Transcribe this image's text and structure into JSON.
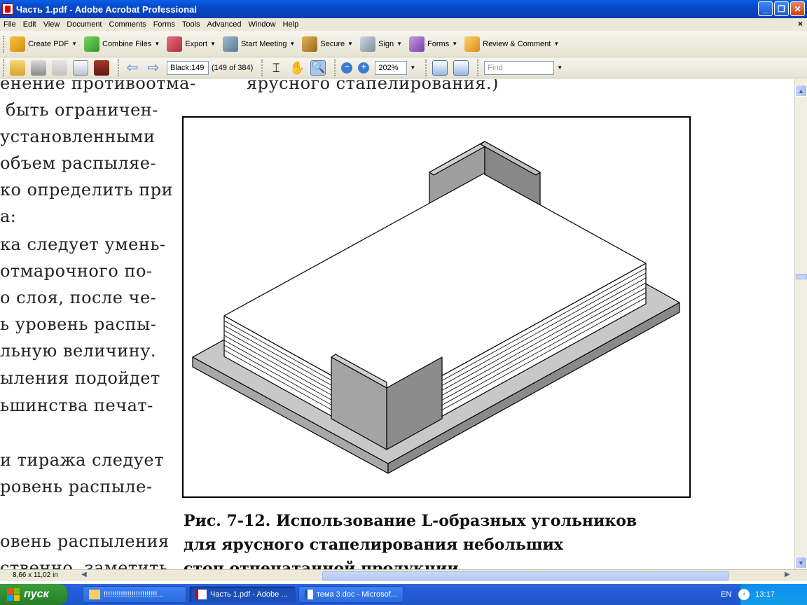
{
  "window": {
    "title": "Часть 1.pdf - Adobe Acrobat Professional"
  },
  "menu": {
    "items": [
      "File",
      "Edit",
      "View",
      "Document",
      "Comments",
      "Forms",
      "Tools",
      "Advanced",
      "Window",
      "Help"
    ],
    "close": "×"
  },
  "toolbar1": {
    "create_pdf": "Create PDF",
    "combine_files": "Combine Files",
    "export": "Export",
    "start_meeting": "Start Meeting",
    "secure": "Secure",
    "sign": "Sign",
    "forms": "Forms",
    "review_comment": "Review & Comment"
  },
  "toolbar2": {
    "page_field": "Black:149",
    "page_count": "(149 of 384)",
    "zoom": "202%",
    "find_placeholder": "Find"
  },
  "document": {
    "left_lines": [
      "енение противоотма-",
      "быть ограничен-",
      "установленными",
      "объем распыляе-",
      "ко определить при",
      "а:",
      "ка следует умень-",
      "отмарочного по-",
      "о слоя, после че-",
      "ь уровень распы-",
      "льную величину.",
      "ыления подойдет",
      "ьшинства печат-",
      "",
      "и тиража следует",
      "ровень распыле-",
      "",
      "овень распыления",
      "ственно, заметить"
    ],
    "top_line": "ярусного стапелирования.)",
    "caption_lines": [
      "Рис. 7-12. Использование L-образных угольников",
      "для ярусного стапелирования небольших",
      "стоп отпечатанной продукции"
    ]
  },
  "status": {
    "page_size": "8,66 x 11,02 in"
  },
  "taskbar": {
    "start": "пуск",
    "items": [
      "!!!!!!!!!!!!!!!!!!!!!!!!!...",
      "Часть 1.pdf - Adobe ...",
      "тема 3.doc - Microsof..."
    ],
    "lang": "EN",
    "clock": "13:17"
  },
  "colors": {
    "titlebar": "#0a5ee6",
    "taskbar": "#245edb",
    "start": "#2f8f2f",
    "tray": "#139de8"
  }
}
